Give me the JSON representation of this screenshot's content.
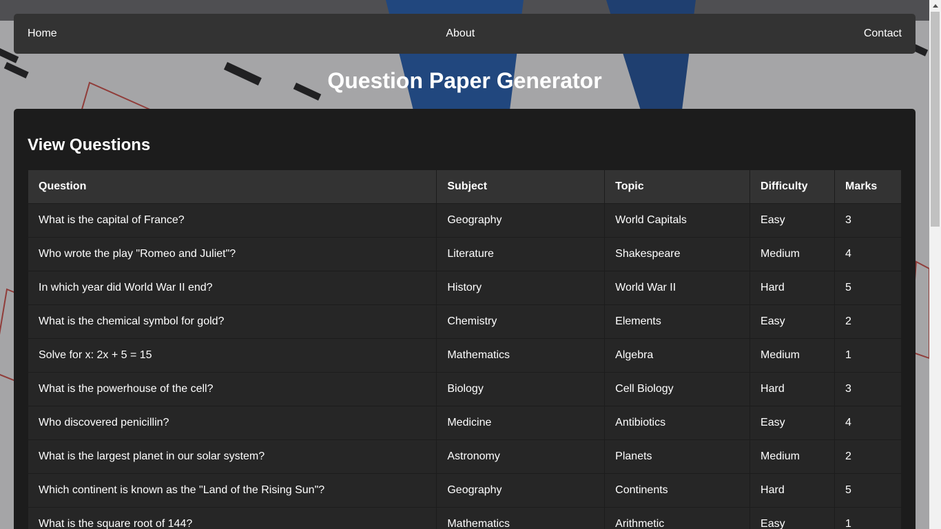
{
  "nav": {
    "home": "Home",
    "about": "About",
    "contact": "Contact"
  },
  "page_title": "Question Paper Generator",
  "section_title": "View Questions",
  "table": {
    "headers": [
      "Question",
      "Subject",
      "Topic",
      "Difficulty",
      "Marks"
    ],
    "rows": [
      [
        "What is the capital of France?",
        "Geography",
        "World Capitals",
        "Easy",
        "3"
      ],
      [
        "Who wrote the play \"Romeo and Juliet\"?",
        "Literature",
        "Shakespeare",
        "Medium",
        "4"
      ],
      [
        "In which year did World War II end?",
        "History",
        "World War II",
        "Hard",
        "5"
      ],
      [
        "What is the chemical symbol for gold?",
        "Chemistry",
        "Elements",
        "Easy",
        "2"
      ],
      [
        "Solve for x: 2x + 5 = 15",
        "Mathematics",
        "Algebra",
        "Medium",
        "1"
      ],
      [
        "What is the powerhouse of the cell?",
        "Biology",
        "Cell Biology",
        "Hard",
        "3"
      ],
      [
        "Who discovered penicillin?",
        "Medicine",
        "Antibiotics",
        "Easy",
        "4"
      ],
      [
        "What is the largest planet in our solar system?",
        "Astronomy",
        "Planets",
        "Medium",
        "2"
      ],
      [
        "Which continent is known as the \"Land of the Rising Sun\"?",
        "Geography",
        "Continents",
        "Hard",
        "5"
      ],
      [
        "What is the square root of 144?",
        "Mathematics",
        "Arithmetic",
        "Easy",
        "1"
      ]
    ]
  }
}
